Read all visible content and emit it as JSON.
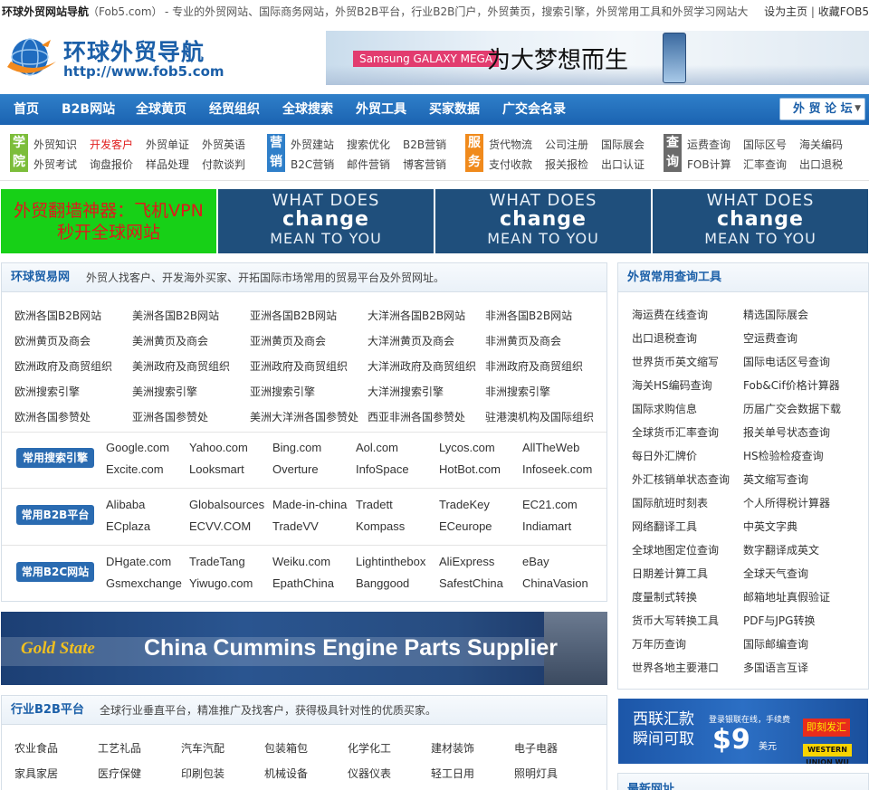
{
  "topbar": {
    "title": "环球外贸网站导航",
    "site": "（Fob5.com）",
    "slogan": "- 专业的外贸网站、国际商务网站，外贸B2B平台，行业B2B门户，外贸黄页，搜索引擎，外贸常用工具和外贸学习网站大",
    "set_home": "设为主页",
    "divider": "|",
    "favorite": "收藏FOB5"
  },
  "logo": {
    "cn": "环球外贸导航",
    "url": "http://www.fob5.com"
  },
  "top_banner": {
    "brand": "Samsung GALAXY MEGA",
    "slogan": "为大梦想而生"
  },
  "nav": {
    "items": [
      "首页",
      "B2B网站",
      "全球黄页",
      "经贸组织",
      "全球搜索",
      "外贸工具",
      "买家数据",
      "广交会名录"
    ],
    "forum": "外 贸 论 坛"
  },
  "quick": {
    "cats": [
      {
        "label": "学院",
        "color": "#7cbd3a",
        "links": [
          [
            "外贸知识",
            "开发客户",
            "外贸单证",
            "外贸英语"
          ],
          [
            "外贸考试",
            "询盘报价",
            "样品处理",
            "付款谈判"
          ]
        ]
      },
      {
        "label": "营销",
        "color": "#2f7fc9",
        "links": [
          [
            "外贸建站",
            "搜索优化",
            "B2B营销"
          ],
          [
            "B2C营销",
            "邮件营销",
            "博客营销"
          ]
        ]
      },
      {
        "label": "服务",
        "color": "#f08a1c",
        "links": [
          [
            "货代物流",
            "公司注册",
            "国际展会"
          ],
          [
            "支付收款",
            "报关报检",
            "出口认证"
          ]
        ]
      },
      {
        "label": "查询",
        "color": "#6b6b6b",
        "links": [
          [
            "运费查询",
            "国际区号",
            "海关编码"
          ],
          [
            "FOB计算",
            "汇率查询",
            "出口退税"
          ]
        ]
      }
    ]
  },
  "ads": {
    "green": [
      "外贸翻墙神器：飞机VPN",
      "秒开全球网站"
    ],
    "blue": [
      "WHAT DOES",
      "change",
      "MEAN TO YOU"
    ]
  },
  "trade_panel": {
    "title": "环球贸易网",
    "desc": "外贸人找客户、开发海外买家、开拓国际市场常用的贸易平台及外贸网址。",
    "grid": [
      [
        "欧洲各国B2B网站",
        "美洲各国B2B网站",
        "亚洲各国B2B网站",
        "大洋洲各国B2B网站",
        "非洲各国B2B网站"
      ],
      [
        "欧洲黄页及商会",
        "美洲黄页及商会",
        "亚洲黄页及商会",
        "大洋洲黄页及商会",
        "非洲黄页及商会"
      ],
      [
        "欧洲政府及商贸组织",
        "美洲政府及商贸组织",
        "亚洲政府及商贸组织",
        "大洋洲政府及商贸组织",
        "非洲政府及商贸组织"
      ],
      [
        "欧洲搜索引擎",
        "美洲搜索引擎",
        "亚洲搜索引擎",
        "大洋洲搜索引擎",
        "非洲搜索引擎"
      ],
      [
        "欧洲各国参赞处",
        "亚洲各国参赞处",
        "美洲大洋洲各国参赞处",
        "西亚非洲各国参赞处",
        "驻港澳机构及国际组织"
      ]
    ],
    "groups": [
      {
        "tag": "常用搜索引擎",
        "rows": [
          [
            "Google.com",
            "Yahoo.com",
            "Bing.com",
            "Aol.com",
            "Lycos.com",
            "AllTheWeb"
          ],
          [
            "Excite.com",
            "Looksmart",
            "Overture",
            "InfoSpace",
            "HotBot.com",
            "Infoseek.com"
          ]
        ]
      },
      {
        "tag": "常用B2B平台",
        "rows": [
          [
            "Alibaba",
            "Globalsources",
            "Made-in-china",
            "Tradett",
            "TradeKey",
            "EC21.com"
          ],
          [
            "ECplaza",
            "ECVV.COM",
            "TradeVV",
            "Kompass",
            "ECeurope",
            "Indiamart"
          ]
        ]
      },
      {
        "tag": "常用B2C网站",
        "rows": [
          [
            "DHgate.com",
            "TradeTang",
            "Weiku.com",
            "Lightinthebox",
            "AliExpress",
            "eBay"
          ],
          [
            "Gsmexchange",
            "Yiwugo.com",
            "EpathChina",
            "Banggood",
            "SafestChina",
            "ChinaVasion"
          ]
        ]
      }
    ]
  },
  "cummins": {
    "brand": "Gold State",
    "text": "China Cummins Engine Parts Supplier"
  },
  "industry_panel": {
    "title": "行业B2B平台",
    "desc": "全球行业垂直平台，精准推广及找客户，获得极具针对性的优质买家。",
    "rows": [
      [
        "农业食品",
        "工艺礼品",
        "汽车汽配",
        "包装箱包",
        "化学化工",
        "建材装饰",
        "电子电器"
      ],
      [
        "家具家居",
        "医疗保健",
        "印刷包装",
        "机械设备",
        "仪器仪表",
        "轻工日用",
        "照明灯具"
      ]
    ]
  },
  "tools_panel": {
    "title": "外贸常用查询工具",
    "rows": [
      [
        "海运费在线查询",
        "精选国际展会"
      ],
      [
        "出口退税查询",
        "空运费查询"
      ],
      [
        "世界货币英文缩写",
        "国际电话区号查询"
      ],
      [
        "海关HS编码查询",
        "Fob&Cif价格计算器"
      ],
      [
        "国际求购信息",
        "历届广交会数据下载"
      ],
      [
        "全球货币汇率查询",
        "报关单号状态查询"
      ],
      [
        "每日外汇牌价",
        "HS检验检疫查询"
      ],
      [
        "外汇核销单状态查询",
        "英文缩写查询"
      ],
      [
        "国际航班时刻表",
        "个人所得税计算器"
      ],
      [
        "网络翻译工具",
        "中英文字典"
      ],
      [
        "全球地图定位查询",
        "数字翻译成英文"
      ],
      [
        "日期差计算工具",
        "全球天气查询"
      ],
      [
        "度量制式转换",
        "邮箱地址真假验证"
      ],
      [
        "货币大写转换工具",
        "PDF与JPG转换"
      ],
      [
        "万年历查询",
        "国际邮编查询"
      ],
      [
        "世界各地主要港口",
        "多国语言互译"
      ]
    ]
  },
  "wu_ad": {
    "line1": "西联汇款",
    "line2": "瞬间可取",
    "small": "登录银联在线，手续费",
    "amount": "$9",
    "unit": "美元",
    "button": "即刻发汇",
    "logo": "WESTERN UNION WU"
  },
  "latest_panel": {
    "title": "最新网址"
  }
}
